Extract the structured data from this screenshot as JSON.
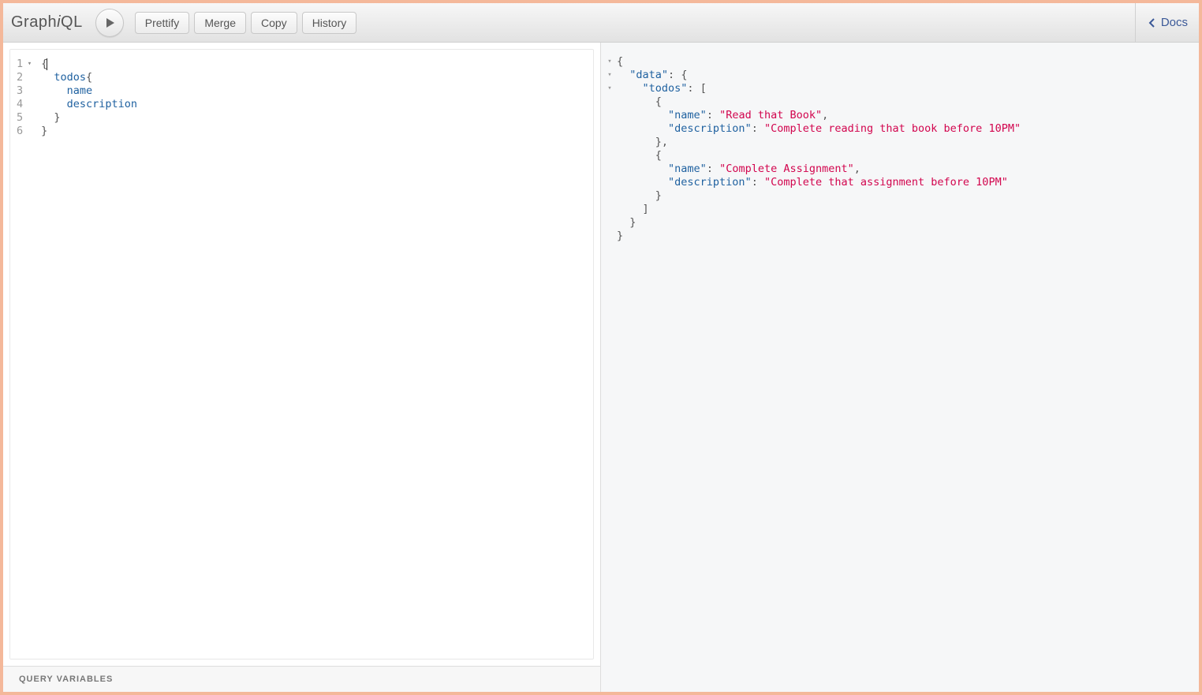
{
  "app": {
    "title_pre": "Graph",
    "title_ital": "i",
    "title_post": "QL"
  },
  "toolbar": {
    "prettify": "Prettify",
    "merge": "Merge",
    "copy": "Copy",
    "history": "History",
    "docs": "Docs"
  },
  "query_editor": {
    "line_numbers": [
      "1",
      "2",
      "3",
      "4",
      "5",
      "6"
    ],
    "fold_rows": [
      "1"
    ],
    "lines": {
      "l1_open": "{",
      "l2_pad": "  ",
      "l2_field": "todos",
      "l2_brace": "{",
      "l3_pad": "    ",
      "l3_field": "name",
      "l4_pad": "    ",
      "l4_field": "description",
      "l5_pad": "  ",
      "l5_close": "}",
      "l6_close": "}"
    }
  },
  "variables": {
    "label": "QUERY VARIABLES"
  },
  "result": {
    "lines": {
      "r1": "{",
      "r2_pad": "  ",
      "r2_key": "\"data\"",
      "r2_colon": ": ",
      "r2_brace": "{",
      "r3_pad": "    ",
      "r3_key": "\"todos\"",
      "r3_colon": ": ",
      "r3_bracket": "[",
      "r4_pad": "      ",
      "r4_brace": "{",
      "r5_pad": "        ",
      "r5_key": "\"name\"",
      "r5_colon": ": ",
      "r5_val": "\"Read that Book\"",
      "r5_comma": ",",
      "r6_pad": "        ",
      "r6_key": "\"description\"",
      "r6_colon": ": ",
      "r6_val": "\"Complete reading that book before 10PM\"",
      "r7_pad": "      ",
      "r7_brace": "}",
      "r7_comma": ",",
      "r8_pad": "      ",
      "r8_brace": "{",
      "r9_pad": "        ",
      "r9_key": "\"name\"",
      "r9_colon": ": ",
      "r9_val": "\"Complete Assignment\"",
      "r9_comma": ",",
      "r10_pad": "        ",
      "r10_key": "\"description\"",
      "r10_colon": ": ",
      "r10_val": "\"Complete that assignment before 10PM\"",
      "r11_pad": "      ",
      "r11_brace": "}",
      "r12_pad": "    ",
      "r12_bracket": "]",
      "r13_pad": "  ",
      "r13_brace": "}",
      "r14": "}"
    }
  }
}
